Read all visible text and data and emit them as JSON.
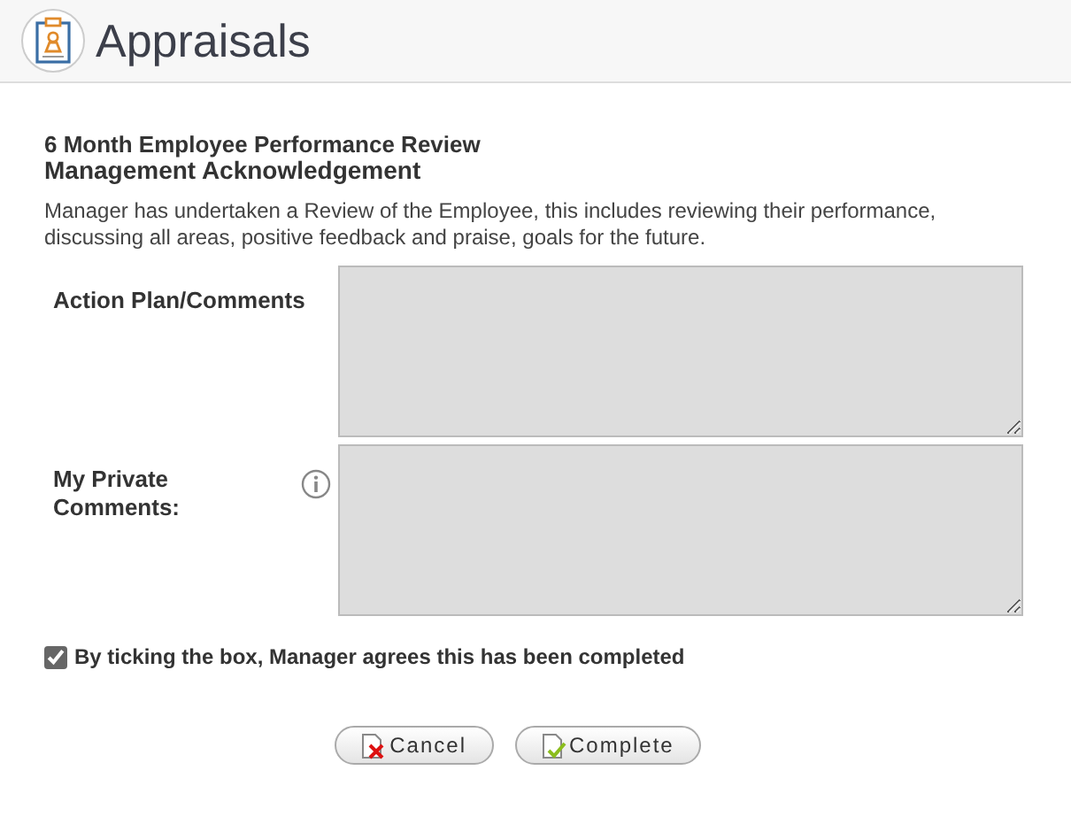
{
  "header": {
    "title": "Appraisals"
  },
  "form": {
    "title": "6 Month Employee Performance Review",
    "subtitle": "Management Acknowledgement",
    "description": "Manager has undertaken a Review of the Employee, this includes reviewing their performance, discussing all areas, positive feedback and praise, goals for the future.",
    "fields": [
      {
        "label": "Action Plan/Comments",
        "info": false
      },
      {
        "label": "My Private Comments:",
        "info": true
      }
    ],
    "agreement": {
      "label": "By ticking the box, Manager agrees this has been completed",
      "checked": true
    },
    "buttons": [
      {
        "label": "Cancel",
        "kind": "cancel"
      },
      {
        "label": "Complete",
        "kind": "complete"
      }
    ]
  }
}
